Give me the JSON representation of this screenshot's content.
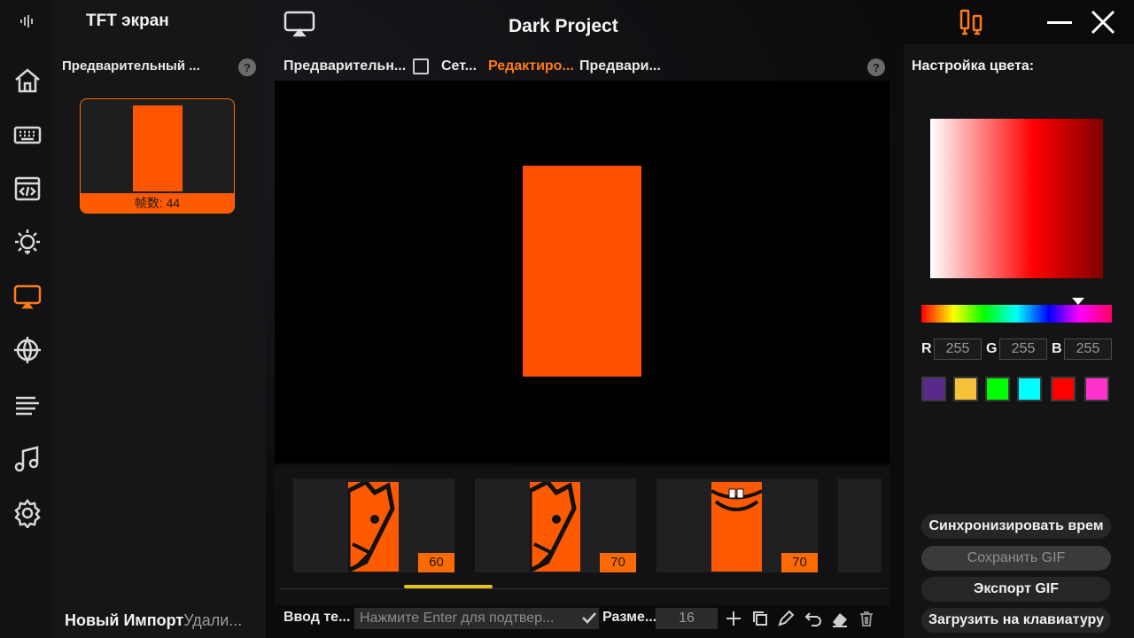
{
  "app": {
    "title": "Dark Project"
  },
  "left_panel": {
    "title": "TFT экран",
    "preview_label": "Предварительный ...",
    "help": "?",
    "frames_label": "帧数: 44",
    "new_import": "Новый Импорт",
    "delete": "Удали..."
  },
  "tabs": {
    "preview": "Предварительн...",
    "grid": "Сет...",
    "edit": "Редактиро...",
    "preview2": "Предвари...",
    "help": "?"
  },
  "frames": [
    {
      "duration": "60"
    },
    {
      "duration": "70"
    },
    {
      "duration": "70"
    }
  ],
  "bottom_bar": {
    "input_label": "Ввод те...",
    "input_placeholder": "Нажмите Enter для подтвер...",
    "size_label": "Разме...",
    "size_value": "16"
  },
  "color_panel": {
    "title": "Настройка цвета:",
    "r_label": "R",
    "g_label": "G",
    "b_label": "B",
    "r": "255",
    "g": "255",
    "b": "255",
    "swatches": [
      "#5a2a8a",
      "#f7c23a",
      "#00ff00",
      "#00ffff",
      "#ff0000",
      "#ff33cc"
    ]
  },
  "buttons": {
    "sync": "Синхронизировать врем",
    "save_gif": "Сохранить GIF",
    "export_gif": "Экспорт GIF",
    "upload": "Загрузить на клавиатуру"
  },
  "colors": {
    "accent": "#ff6a00",
    "scroll": "#e6c21a"
  }
}
